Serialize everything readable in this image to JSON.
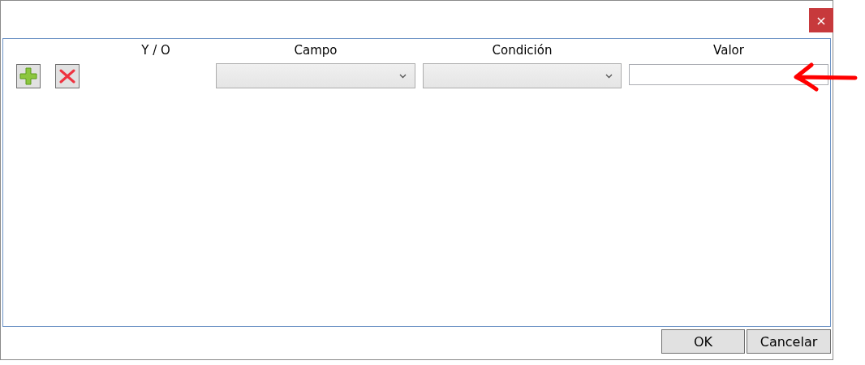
{
  "window": {
    "close_glyph": "×"
  },
  "columns": [
    "Y / O",
    "Campo",
    "Condición",
    "Valor"
  ],
  "filter_row": {
    "cells": [
      {
        "kind": "combo"
      },
      {
        "kind": "combo"
      },
      {
        "kind": "text"
      }
    ]
  },
  "buttons": [
    "OK",
    "Cancelar"
  ]
}
